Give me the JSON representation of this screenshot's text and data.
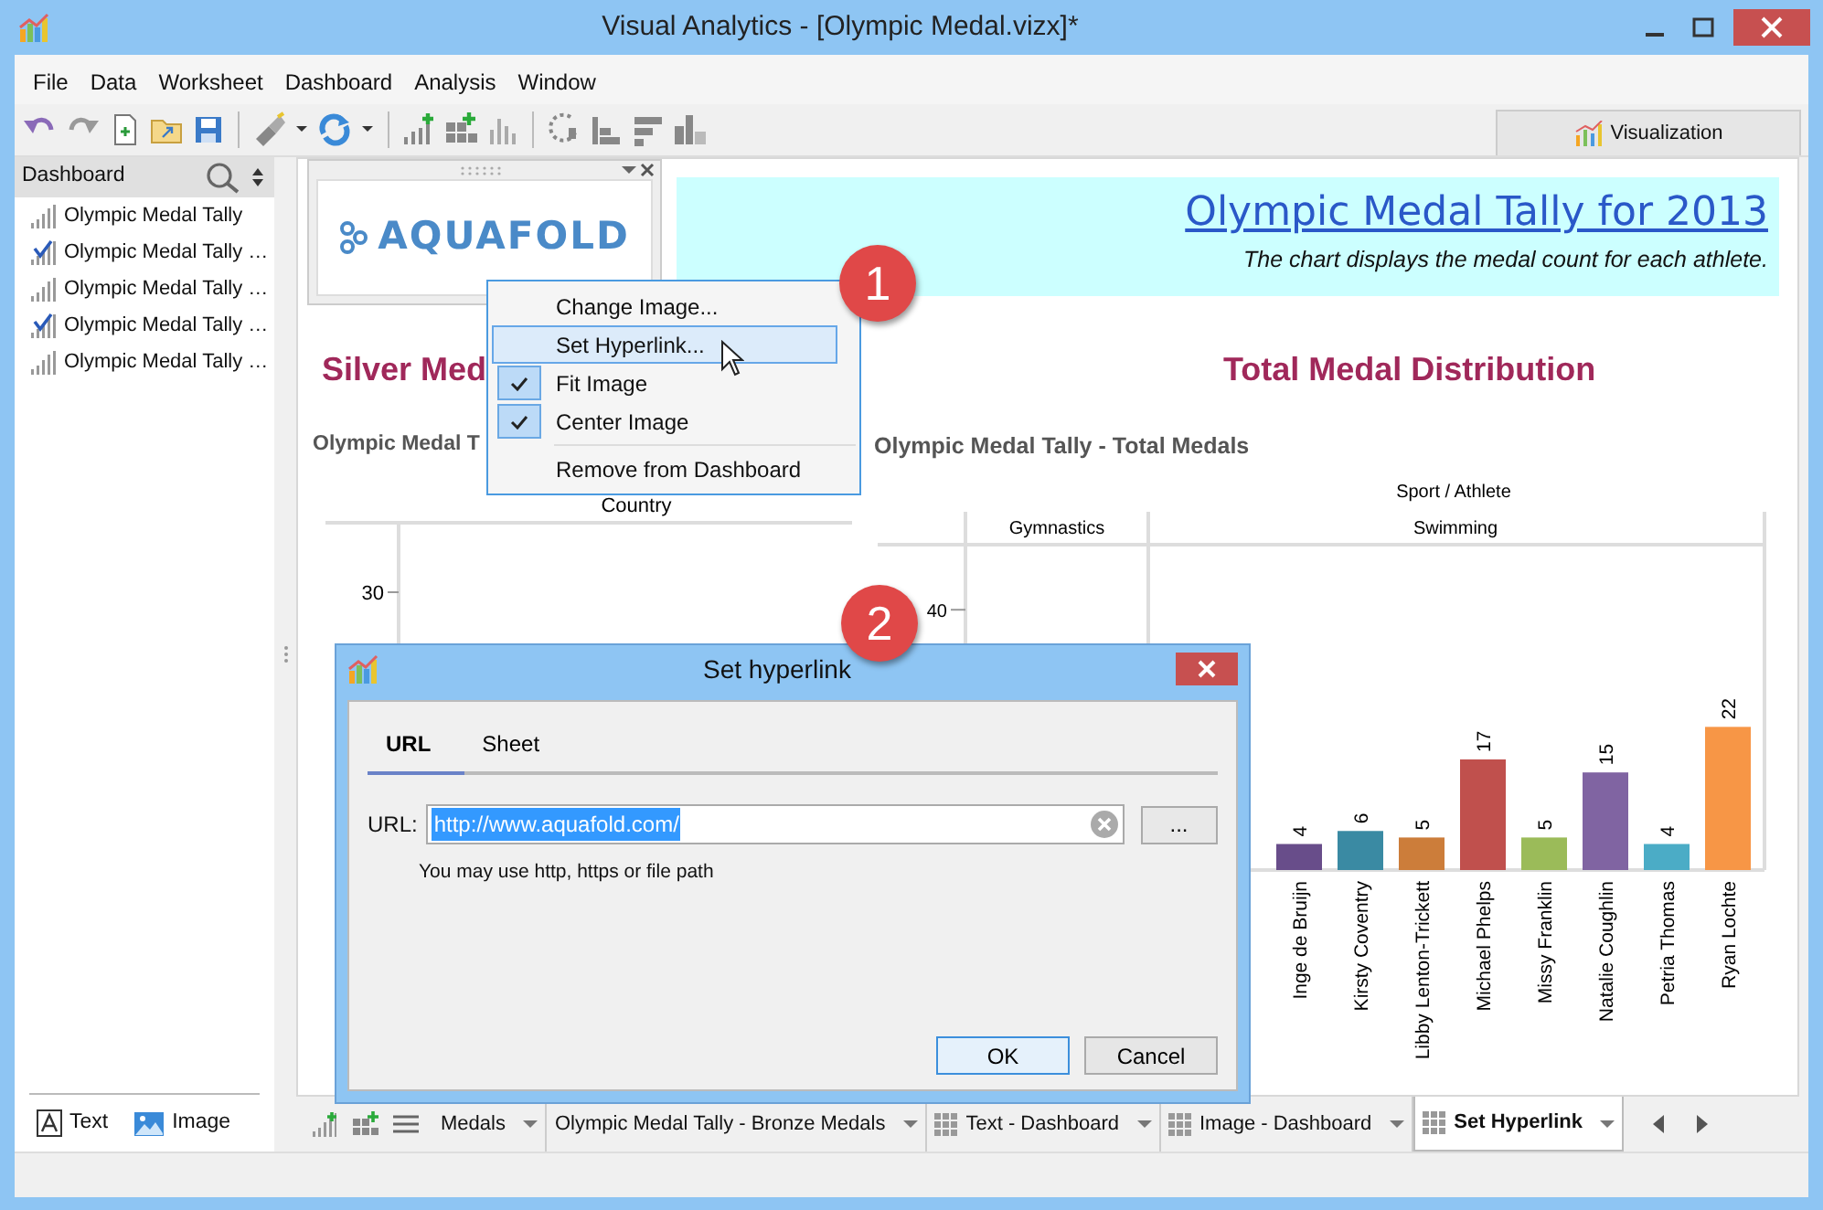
{
  "window": {
    "title": "Visual Analytics - [Olympic Medal.vizx]*"
  },
  "menu": [
    "File",
    "Data",
    "Worksheet",
    "Dashboard",
    "Analysis",
    "Window"
  ],
  "toolbar_tab": {
    "label": "Visualization"
  },
  "sidebar": {
    "title": "Dashboard",
    "items": [
      {
        "label": "Olympic Medal Tally",
        "kind": "chart"
      },
      {
        "label": "Olympic Medal Tally …",
        "kind": "checked"
      },
      {
        "label": "Olympic Medal Tally …",
        "kind": "chart"
      },
      {
        "label": "Olympic Medal Tally …",
        "kind": "checked"
      },
      {
        "label": "Olympic Medal Tally …",
        "kind": "chart"
      }
    ],
    "tools": [
      {
        "label": "Text",
        "kind": "text"
      },
      {
        "label": "Image",
        "kind": "image"
      }
    ]
  },
  "canvas": {
    "logo": "AQUAFOLD",
    "header": {
      "title": "Olympic Medal Tally for 2013",
      "subtitle": "The chart displays the medal count for each athlete."
    },
    "left_panel": {
      "heading": "Silver Med",
      "chart_title": "Olympic Medal T",
      "axis_label": "Country",
      "tick": "30"
    },
    "right_panel": {
      "heading": "Total Medal Distribution",
      "chart_title": "Olympic Medal Tally - Total Medals",
      "panes": [
        "Gymnastics",
        "Swimming"
      ],
      "tick": "40",
      "chart_data": {
        "type": "bar",
        "xlabel": "Sport / Athlete",
        "categories": [
          "Inge de Bruijn",
          "Kirsty Coventry",
          "Libby Lenton-Trickett",
          "Michael Phelps",
          "Missy Franklin",
          "Natalie Coughlin",
          "Petria Thomas",
          "Ryan Lochte"
        ],
        "values": [
          4,
          6,
          5,
          17,
          5,
          15,
          4,
          22
        ],
        "colors": [
          "#684d8a",
          "#3a8aa3",
          "#cc7d3a",
          "#c0504d",
          "#9bbb59",
          "#8064a2",
          "#4bacc6",
          "#f79646"
        ],
        "ylim": [
          0,
          50
        ],
        "data_labels": true
      }
    }
  },
  "context_menu": {
    "items": [
      {
        "label": "Change Image...",
        "selected": false,
        "checked": false,
        "separator_before": false
      },
      {
        "label": "Set Hyperlink...",
        "selected": true,
        "checked": false,
        "separator_before": false
      },
      {
        "label": "Fit Image",
        "selected": false,
        "checked": true,
        "separator_before": false
      },
      {
        "label": "Center Image",
        "selected": false,
        "checked": true,
        "separator_before": false
      },
      {
        "label": "Remove from Dashboard",
        "selected": false,
        "checked": false,
        "separator_before": true
      }
    ]
  },
  "callouts": [
    "1",
    "2"
  ],
  "dialog": {
    "title": "Set hyperlink",
    "tabs": [
      {
        "label": "URL",
        "selected": true
      },
      {
        "label": "Sheet",
        "selected": false
      }
    ],
    "url_label": "URL:",
    "url_value": "http://www.aquafold.com/",
    "url_selected": true,
    "browse_button": "...",
    "hint": "You may use http, https or file path",
    "buttons": [
      {
        "label": "OK",
        "default": true
      },
      {
        "label": "Cancel",
        "default": false
      }
    ]
  },
  "sheet_tabs": [
    {
      "label": "Medals",
      "kind": "sheet",
      "selected": false
    },
    {
      "label": "Olympic Medal Tally - Bronze Medals",
      "kind": "sheet",
      "selected": false
    },
    {
      "label": "Text - Dashboard",
      "kind": "dashboard",
      "selected": false
    },
    {
      "label": "Image - Dashboard",
      "kind": "dashboard",
      "selected": false
    },
    {
      "label": "Set Hyperlink",
      "kind": "dashboard",
      "selected": true
    }
  ]
}
